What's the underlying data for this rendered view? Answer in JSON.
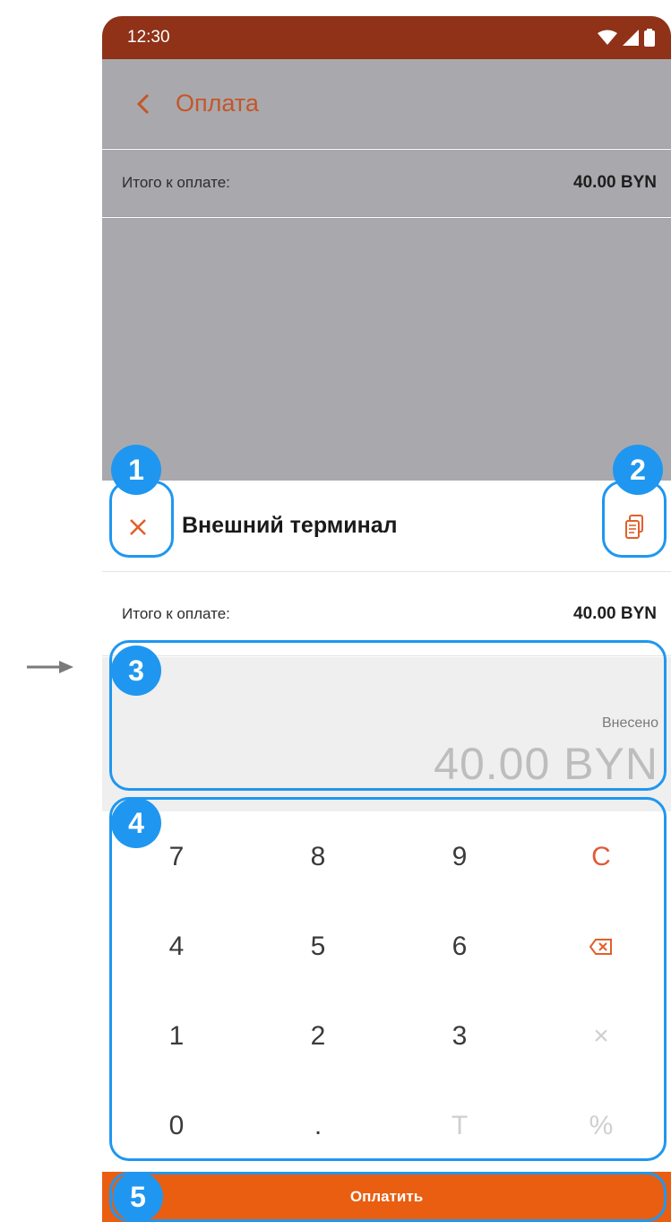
{
  "colors": {
    "status_bar": "#8f3218",
    "accent": "#c4562a",
    "pay_button": "#e95e10",
    "overlay": "#a9a9ad",
    "highlight": "#1f97f0"
  },
  "status_bar": {
    "time": "12:30",
    "icons": [
      "wifi-icon",
      "signal-icon",
      "battery-icon"
    ]
  },
  "app_bar": {
    "back_icon": "chevron-left-icon",
    "title": "Оплата"
  },
  "background_summary": {
    "label": "Итого к оплате:",
    "value": "40.00 BYN"
  },
  "sheet": {
    "close_icon": "close-icon",
    "title": "Внешний терминал",
    "receipt_icon": "receipt-icon",
    "total_label": "Итого к оплате:",
    "total_value": "40.00 BYN",
    "amount_label": "Внесено",
    "amount_value": "40.00 BYN"
  },
  "keypad": {
    "rows": [
      [
        "7",
        "8",
        "9",
        "C"
      ],
      [
        "4",
        "5",
        "6",
        "⌫"
      ],
      [
        "1",
        "2",
        "3",
        "×"
      ],
      [
        "0",
        ".",
        "T",
        "%"
      ]
    ]
  },
  "pay_button": {
    "label": "Оплатить"
  },
  "annotations": [
    "1",
    "2",
    "3",
    "4",
    "5"
  ]
}
